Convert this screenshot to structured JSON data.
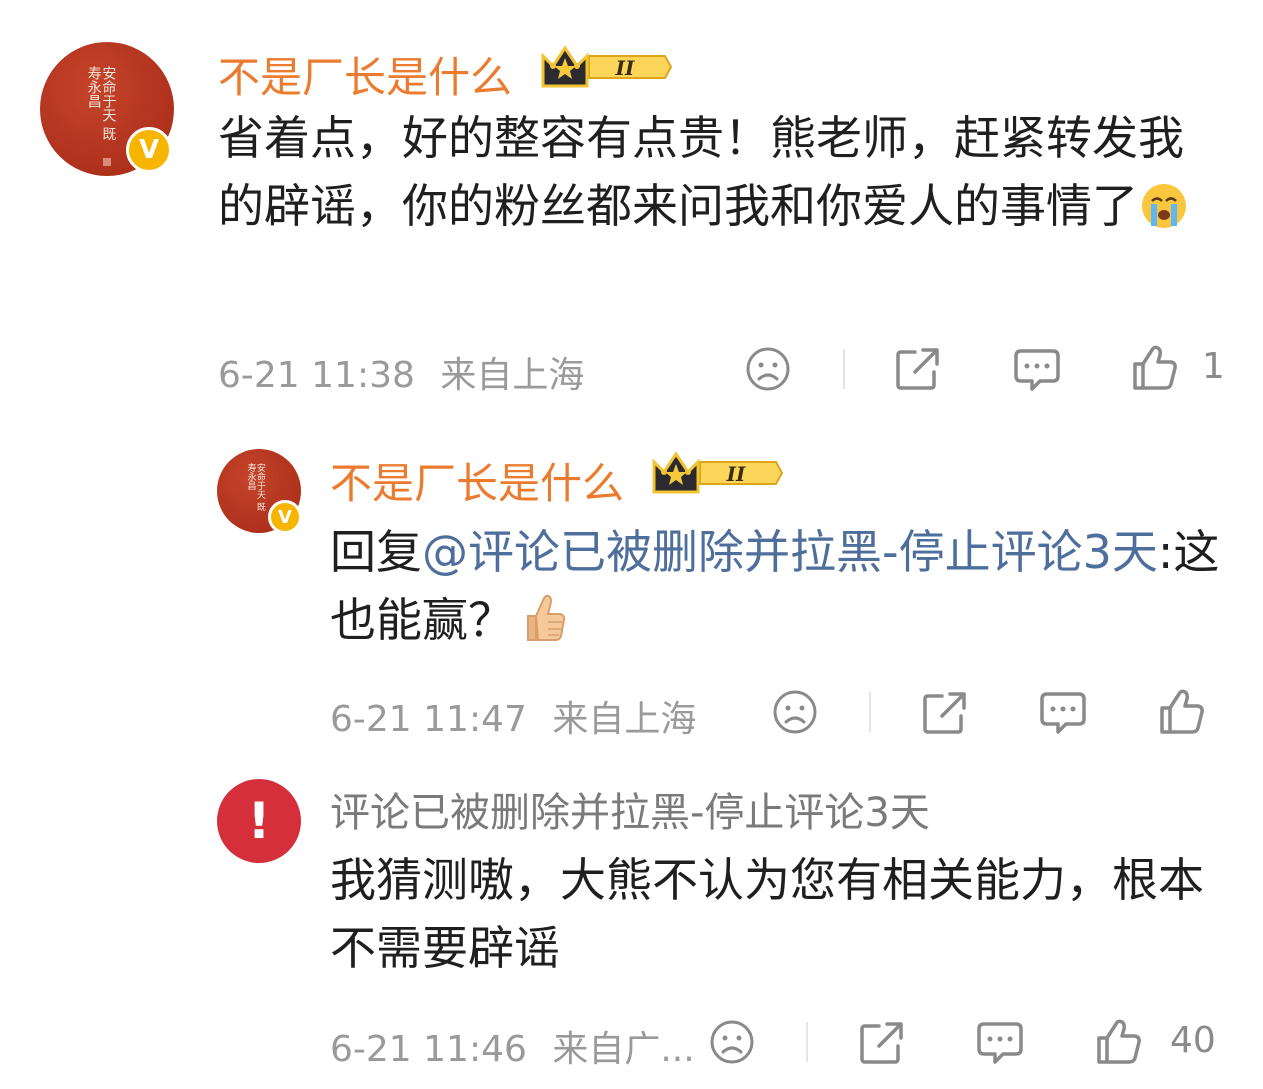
{
  "comments": [
    {
      "username": "不是厂长是什么",
      "level": "II",
      "avatar_seal_text": "安命于天 既寿永昌",
      "content": "省着点，好的整容有点贵！熊老师，赶紧转发我的辟谣，你的粉丝都来问我和你爱人的事情了",
      "emoji": "crying-emoji",
      "time": "6-21 11:38",
      "location": "来自上海",
      "likes": "1"
    },
    {
      "username": "不是厂长是什么",
      "level": "II",
      "avatar_seal_text": "安命于天 既寿永昌",
      "reply_prefix": "回复",
      "mention": "@评论已被删除并拉黑-停止评论3天",
      "reply_text": ":这也能赢？",
      "emoji": "thumbs-up-emoji",
      "time": "6-21 11:47",
      "location": "来自上海",
      "likes": ""
    },
    {
      "username": "评论已被删除并拉黑-停止评论3天",
      "avatar_symbol": "!",
      "content": "我猜测嗷，大熊不认为您有相关能力，根本不需要辟谣",
      "time": "6-21 11:46",
      "location": "来自广...",
      "likes": "40"
    }
  ],
  "colors": {
    "username": "#eb7b2e",
    "mention": "#4e6e9c",
    "meta": "#9a9a9a",
    "badge": "#f7b500",
    "alert": "#d42f3a"
  }
}
